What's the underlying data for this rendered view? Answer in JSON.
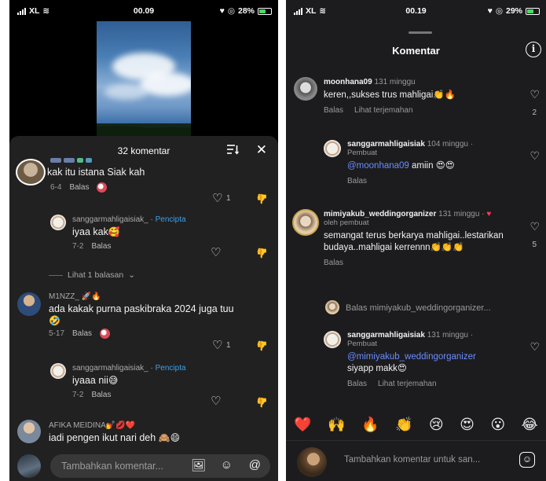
{
  "left_screen": {
    "status": {
      "carrier": "XL",
      "time": "00.09",
      "battery": "28%"
    },
    "sheet": {
      "title": "32 komentar"
    },
    "comments": [
      {
        "text": "kak itu istana Siak kah",
        "time": "6-4",
        "reply": "Balas",
        "likes": "1"
      },
      {
        "username": "sanggarmahligaisiak_",
        "creator": "Pencipta",
        "text": "iyaa kak",
        "emoji": "🥰",
        "time": "7-2",
        "reply": "Balas"
      },
      {
        "username": "M1NZZ_",
        "username_emoji": "🚀🔥",
        "text": "ada kakak purna paskibraka 2024 juga tuu",
        "emoji": "🤣",
        "time": "5-17",
        "reply": "Balas",
        "likes": "1"
      },
      {
        "username": "sanggarmahligaisiak_",
        "creator": "Pencipta",
        "text": "iyaaa nii",
        "emoji": "😅",
        "time": "7-2",
        "reply": "Balas"
      },
      {
        "username": "AFIKA MEIDINA",
        "username_emoji": "💅💋❤️",
        "text": "iadi pengen ikut nari deh",
        "emoji": "🙈😄"
      }
    ],
    "view_replies": "Lihat 1 balasan",
    "input": {
      "placeholder": "Tambahkan komentar..."
    }
  },
  "right_screen": {
    "status": {
      "carrier": "XL",
      "time": "00.19",
      "battery": "29%"
    },
    "title": "Komentar",
    "comments": [
      {
        "username": "moonhana09",
        "time": "131 minggu",
        "text": "keren,,sukses trus mahligai",
        "emoji": "👏🔥",
        "reply": "Balas",
        "translate": "Lihat terjemahan",
        "likes": "2"
      },
      {
        "username": "sanggarmahligaisiak",
        "time": "104 minggu ·",
        "sub": "Pembuat",
        "mention": "@moonhana09",
        "text": " amiin",
        "emoji": "😍😍",
        "reply": "Balas"
      },
      {
        "username": "mimiyakub_weddingorganizer",
        "time": "131 minggu ·",
        "liked_by": "oleh pembuat",
        "text": "semangat terus berkarya mahligai..lestarikan budaya..mahligai kerrennn",
        "emoji": "👏👏👏",
        "reply": "Balas",
        "likes": "5"
      },
      {
        "username": "sanggarmahligaisiak",
        "time": "131 minggu ·",
        "sub": "Pembuat",
        "mention": "@mimiyakub_weddingorganizer",
        "text": "siyapp makk",
        "emoji": "😍",
        "reply": "Balas",
        "translate": "Lihat terjemahan"
      }
    ],
    "reply_to": "Balas mimiyakub_weddingorganizer...",
    "reactions": [
      "❤️",
      "🙌",
      "🔥",
      "👏",
      "😢",
      "😍",
      "😮",
      "😂"
    ],
    "input": {
      "placeholder": "Tambahkan komentar untuk san..."
    }
  }
}
